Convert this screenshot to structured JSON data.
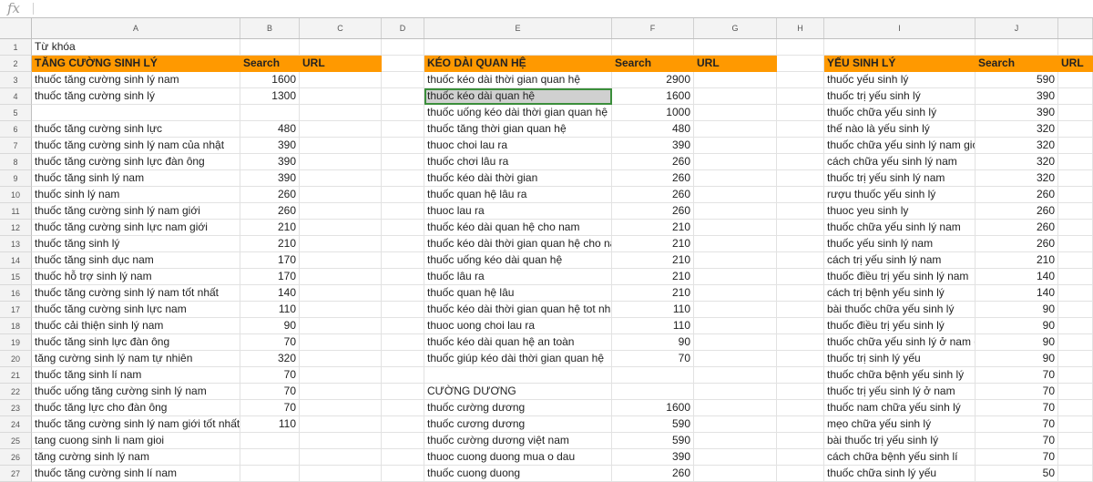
{
  "formula_bar": {
    "icon": "fx",
    "value": ""
  },
  "column_headers": [
    "A",
    "B",
    "C",
    "D",
    "E",
    "F",
    "G",
    "H",
    "I",
    "J",
    ""
  ],
  "row1": {
    "a": "Từ khóa"
  },
  "headers": {
    "a": "TĂNG CƯỜNG SINH LÝ",
    "b": "Search",
    "c": "URL",
    "e": "KÉO DÀI QUAN HỆ",
    "f": "Search",
    "g": "URL",
    "i": "YẾU SINH LÝ",
    "j": "Search",
    "k": "URL"
  },
  "rows": [
    {
      "n": "1"
    },
    {
      "n": "2"
    },
    {
      "n": "3",
      "a": "thuốc tăng cường sinh lý nam",
      "b": "1600",
      "e": "thuốc kéo dài thời gian quan hệ",
      "f": "2900",
      "i": "thuốc yếu sinh lý",
      "j": "590"
    },
    {
      "n": "4",
      "a": "thuốc tăng cường sinh lý",
      "b": "1300",
      "e": "thuốc kéo dài quan hệ",
      "f": "1600",
      "i": "thuốc trị yếu sinh lý",
      "j": "390"
    },
    {
      "n": "5",
      "a": "",
      "b": "",
      "e": "thuốc uống kéo dài thời gian quan hệ",
      "f": "1000",
      "i": "thuốc chữa yếu sinh lý",
      "j": "390"
    },
    {
      "n": "6",
      "a": "thuốc tăng cường sinh lực",
      "b": "480",
      "e": "thuốc tăng thời gian quan hệ",
      "f": "480",
      "i": "thế nào là yếu sinh lý",
      "j": "320"
    },
    {
      "n": "7",
      "a": "thuốc tăng cường sinh lý nam của nhật",
      "b": "390",
      "e": "thuoc choi lau ra",
      "f": "390",
      "i": "thuốc chữa yếu sinh lý nam gió",
      "j": "320"
    },
    {
      "n": "8",
      "a": "thuốc tăng cường sinh lực đàn ông",
      "b": "390",
      "e": "thuốc chơi lâu ra",
      "f": "260",
      "i": "cách chữa yếu sinh lý nam",
      "j": "320"
    },
    {
      "n": "9",
      "a": "thuốc tăng sinh lý nam",
      "b": "390",
      "e": "thuốc kéo dài thời gian",
      "f": "260",
      "i": "thuốc trị yếu sinh lý nam",
      "j": "320"
    },
    {
      "n": "10",
      "a": "thuốc sinh lý nam",
      "b": "260",
      "e": "thuốc quan hệ lâu ra",
      "f": "260",
      "i": "rượu thuốc yếu sinh lý",
      "j": "260"
    },
    {
      "n": "11",
      "a": "thuốc tăng cường sinh lý nam giới",
      "b": "260",
      "e": "thuoc lau ra",
      "f": "260",
      "i": "thuoc yeu sinh ly",
      "j": "260"
    },
    {
      "n": "12",
      "a": "thuốc tăng cường sinh lực nam giới",
      "b": "210",
      "e": "thuốc kéo dài quan hệ cho nam",
      "f": "210",
      "i": "thuốc chữa yếu sinh lý nam",
      "j": "260"
    },
    {
      "n": "13",
      "a": "thuốc tăng sinh lý",
      "b": "210",
      "e": "thuốc kéo dài thời gian quan hệ cho na",
      "f": "210",
      "i": "thuốc yếu sinh lý nam",
      "j": "260"
    },
    {
      "n": "14",
      "a": "thuốc tăng sinh dục nam",
      "b": "170",
      "e": "thuốc uống kéo dài quan hệ",
      "f": "210",
      "i": "cách trị yếu sinh lý nam",
      "j": "210"
    },
    {
      "n": "15",
      "a": "thuốc hỗ trợ sinh lý nam",
      "b": "170",
      "e": "thuốc lâu ra",
      "f": "210",
      "i": "thuốc điều trị yếu sinh lý nam",
      "j": "140"
    },
    {
      "n": "16",
      "a": "thuốc tăng cường sinh lý nam tốt nhất",
      "b": "140",
      "e": "thuốc quan hệ lâu",
      "f": "210",
      "i": "cách trị bệnh yếu sinh lý",
      "j": "140"
    },
    {
      "n": "17",
      "a": "thuốc tăng cường sinh lực nam",
      "b": "110",
      "e": "thuốc kéo dài thời gian quan hệ tot nha",
      "f": "110",
      "i": "bài thuốc chữa yếu sinh lý",
      "j": "90"
    },
    {
      "n": "18",
      "a": "thuốc cải thiện sinh lý nam",
      "b": "90",
      "e": "thuoc uong choi lau ra",
      "f": "110",
      "i": "thuốc điều trị yếu sinh lý",
      "j": "90"
    },
    {
      "n": "19",
      "a": "thuốc tăng sinh lực đàn ông",
      "b": "70",
      "e": "thuốc kéo dài quan hệ an toàn",
      "f": "90",
      "i": "thuốc chữa yếu sinh lý ở nam g",
      "j": "90"
    },
    {
      "n": "20",
      "a": "tăng cường sinh lý nam tự nhiên",
      "b": "320",
      "e": "thuốc giúp kéo dài thời gian quan hệ",
      "f": "70",
      "i": "thuốc trị sinh lý yếu",
      "j": "90"
    },
    {
      "n": "21",
      "a": "thuốc tăng sinh lí nam",
      "b": "70",
      "e": "",
      "f": "",
      "i": "thuốc chữa bệnh yếu sinh lý",
      "j": "70"
    },
    {
      "n": "22",
      "a": "thuốc uống tăng cường sinh lý nam",
      "b": "70",
      "e": "CƯỜNG DƯƠNG",
      "f": "",
      "i": "thuốc trị yếu sinh lý ở nam",
      "j": "70"
    },
    {
      "n": "23",
      "a": "thuốc tăng lực cho đàn ông",
      "b": "70",
      "e": "thuốc cường dương",
      "f": "1600",
      "i": "thuốc nam chữa yếu sinh lý",
      "j": "70"
    },
    {
      "n": "24",
      "a": "thuốc tăng cường sinh lý nam giới tốt nhất",
      "b": "110",
      "e": "thuốc cương dương",
      "f": "590",
      "i": "mẹo chữa yếu sinh lý",
      "j": "70"
    },
    {
      "n": "25",
      "a": "tang cuong sinh li nam gioi",
      "b": "",
      "e": "thuốc cường dương việt nam",
      "f": "590",
      "i": "bài thuốc trị yếu sinh lý",
      "j": "70"
    },
    {
      "n": "26",
      "a": "tăng cường sinh lý nam",
      "b": "",
      "e": "thuoc cuong duong mua o dau",
      "f": "390",
      "i": "cách chữa bệnh yếu sinh lí",
      "j": "70"
    },
    {
      "n": "27",
      "a": "thuốc tăng cường sinh lí nam",
      "b": "",
      "e": "thuốc cuong duong",
      "f": "260",
      "i": "thuốc chữa sinh lý yếu",
      "j": "50"
    }
  ],
  "colors": {
    "header_bg": "#ff9900",
    "selection_border": "#3b8e3b",
    "grid_line": "#e2e2e2"
  }
}
